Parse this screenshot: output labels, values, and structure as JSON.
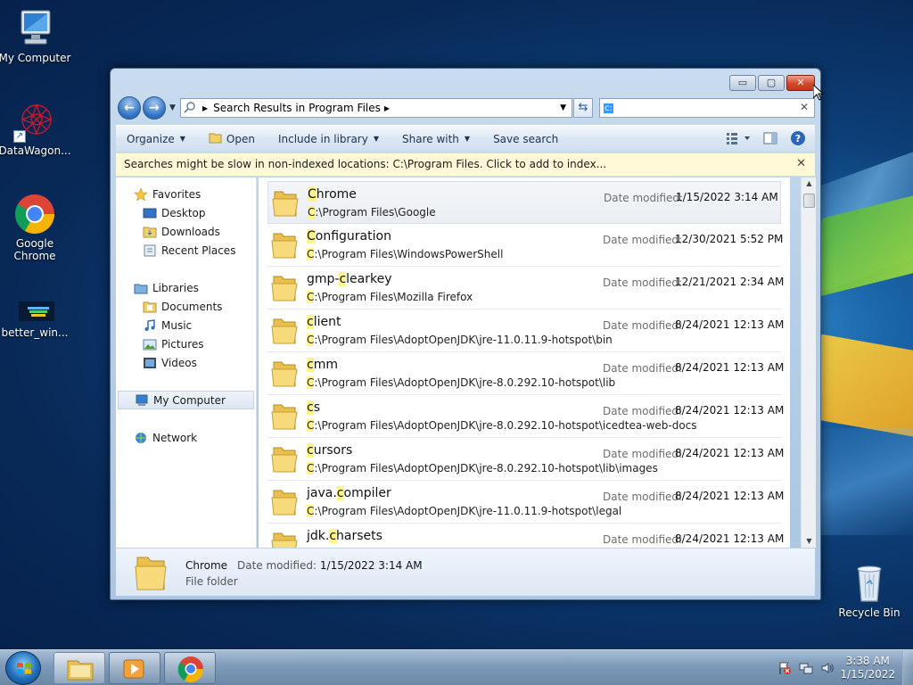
{
  "desktop": {
    "icons": [
      {
        "label": "My Computer",
        "icon": "computer-icon"
      },
      {
        "label": "DataWagon...",
        "icon": "datawagon-icon"
      },
      {
        "label": "Google Chrome",
        "icon": "chrome-icon"
      },
      {
        "label": "better_win...",
        "icon": "image-file-icon"
      },
      {
        "label": "Recycle Bin",
        "icon": "recycle-bin-icon"
      }
    ]
  },
  "window": {
    "caption_buttons": {
      "minimize": "▭",
      "maximize": "▢",
      "close": "✕"
    },
    "address": {
      "crumb": "Search Results in Program Files"
    },
    "search": {
      "value": "c:"
    },
    "toolbar": {
      "organize": "Organize",
      "open": "Open",
      "include_in_library": "Include in library",
      "share_with": "Share with",
      "save_search": "Save search"
    },
    "infobar": {
      "text": "Searches might be slow in non-indexed locations: C:\\Program Files. Click to add to index..."
    },
    "nav": {
      "favorites": "Favorites",
      "desktop": "Desktop",
      "downloads": "Downloads",
      "recent_places": "Recent Places",
      "libraries": "Libraries",
      "documents": "Documents",
      "music": "Music",
      "pictures": "Pictures",
      "videos": "Videos",
      "my_computer": "My Computer",
      "network": "Network"
    },
    "date_label": "Date modified:",
    "results": [
      {
        "hl": "C",
        "rest": "hrome",
        "path_hl": "C",
        "path_rest": ":\\Program Files\\Google",
        "date": "1/15/2022 3:14 AM"
      },
      {
        "hl": "C",
        "rest": "onfiguration",
        "path_hl": "C",
        "path_rest": ":\\Program Files\\WindowsPowerShell",
        "date": "12/30/2021 5:52 PM"
      },
      {
        "pre": "gmp-",
        "hl": "c",
        "rest": "learkey",
        "path_hl": "C",
        "path_rest": ":\\Program Files\\Mozilla Firefox",
        "date": "12/21/2021 2:34 AM"
      },
      {
        "hl": "c",
        "rest": "lient",
        "path_hl": "C",
        "path_rest": ":\\Program Files\\AdoptOpenJDK\\jre-11.0.11.9-hotspot\\bin",
        "date": "8/24/2021 12:13 AM"
      },
      {
        "hl": "c",
        "rest": "mm",
        "path_hl": "C",
        "path_rest": ":\\Program Files\\AdoptOpenJDK\\jre-8.0.292.10-hotspot\\lib",
        "date": "8/24/2021 12:13 AM"
      },
      {
        "hl": "c",
        "rest": "s",
        "path_hl": "C",
        "path_rest": ":\\Program Files\\AdoptOpenJDK\\jre-8.0.292.10-hotspot\\icedtea-web-docs",
        "date": "8/24/2021 12:13 AM"
      },
      {
        "hl": "c",
        "rest": "ursors",
        "path_hl": "C",
        "path_rest": ":\\Program Files\\AdoptOpenJDK\\jre-8.0.292.10-hotspot\\lib\\images",
        "date": "8/24/2021 12:13 AM"
      },
      {
        "pre": "java.",
        "hl": "c",
        "rest": "ompiler",
        "path_hl": "C",
        "path_rest": ":\\Program Files\\AdoptOpenJDK\\jre-11.0.11.9-hotspot\\legal",
        "date": "8/24/2021 12:13 AM"
      },
      {
        "pre": "jdk.",
        "hl": "c",
        "rest": "harsets",
        "path_hl": "",
        "path_rest": "",
        "date": "8/24/2021 12:13 AM"
      }
    ],
    "details": {
      "name": "Chrome",
      "type": "File folder",
      "modified_label": "Date modified:",
      "modified_value": "1/15/2022 3:14 AM"
    }
  },
  "taskbar": {
    "time": "3:38 AM",
    "date": "1/15/2022"
  },
  "colors": {
    "highlight": "#fff38a",
    "folder": "#f2d16b",
    "close_button": "#d3472b"
  }
}
